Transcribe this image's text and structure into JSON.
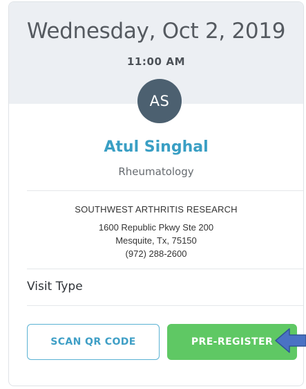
{
  "appointment": {
    "date": "Wednesday, Oct 2, 2019",
    "time": "11:00 AM"
  },
  "provider": {
    "initials": "AS",
    "name": "Atul Singhal",
    "specialty": "Rheumatology"
  },
  "location": {
    "name": "SOUTHWEST ARTHRITIS RESEARCH",
    "address_line1": "1600 Republic Pkwy Ste 200",
    "address_line2": "Mesquite, Tx, 75150",
    "phone": "(972) 288-2600"
  },
  "visit": {
    "label": "Visit Type"
  },
  "actions": {
    "scan_label": "SCAN QR CODE",
    "preregister_label": "PRE-REGISTER"
  },
  "colors": {
    "accent": "#3a9fc4",
    "avatar": "#4c6070",
    "primary_button": "#5fc864",
    "header_bg": "#eceff3",
    "arrow_annotation": "#4a72c4"
  },
  "icons": {
    "annotation": "arrow-left-icon"
  }
}
